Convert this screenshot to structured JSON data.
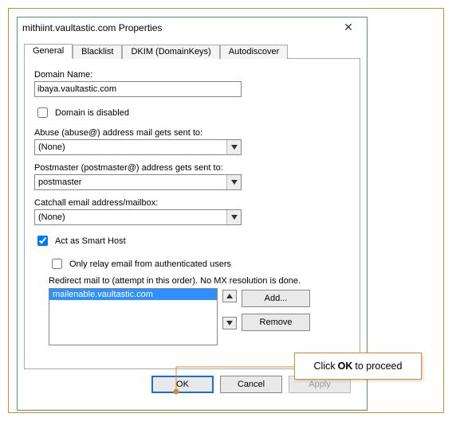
{
  "window": {
    "title": "mithiint.vaultastic.com Properties",
    "close_symbol": "✕"
  },
  "tabs": [
    "General",
    "Blacklist",
    "DKIM (DomainKeys)",
    "Autodiscover"
  ],
  "general": {
    "domain_name_label": "Domain Name:",
    "domain_name_value": "ibaya.vaultastic.com",
    "domain_disabled_label": "Domain is disabled",
    "domain_disabled_checked": false,
    "abuse_label": "Abuse (abuse@) address mail gets sent to:",
    "abuse_value": "(None)",
    "postmaster_label": "Postmaster (postmaster@) address gets sent to:",
    "postmaster_value": "postmaster",
    "catchall_label": "Catchall email address/mailbox:",
    "catchall_value": "(None)",
    "smart_host_label": "Act as Smart Host",
    "smart_host_checked": true,
    "only_relay_label": "Only relay email from authenticated users",
    "only_relay_checked": false,
    "redirect_label": "Redirect mail to (attempt in this order). No MX resolution is done.",
    "redirect_items": [
      "mailenable.vaultastic.com"
    ],
    "add_label": "Add...",
    "remove_label": "Remove"
  },
  "buttons": {
    "ok": "OK",
    "cancel": "Cancel",
    "apply": "Apply"
  },
  "callout": {
    "prefix": "Click",
    "bold": "OK",
    "suffix": "to proceed"
  }
}
